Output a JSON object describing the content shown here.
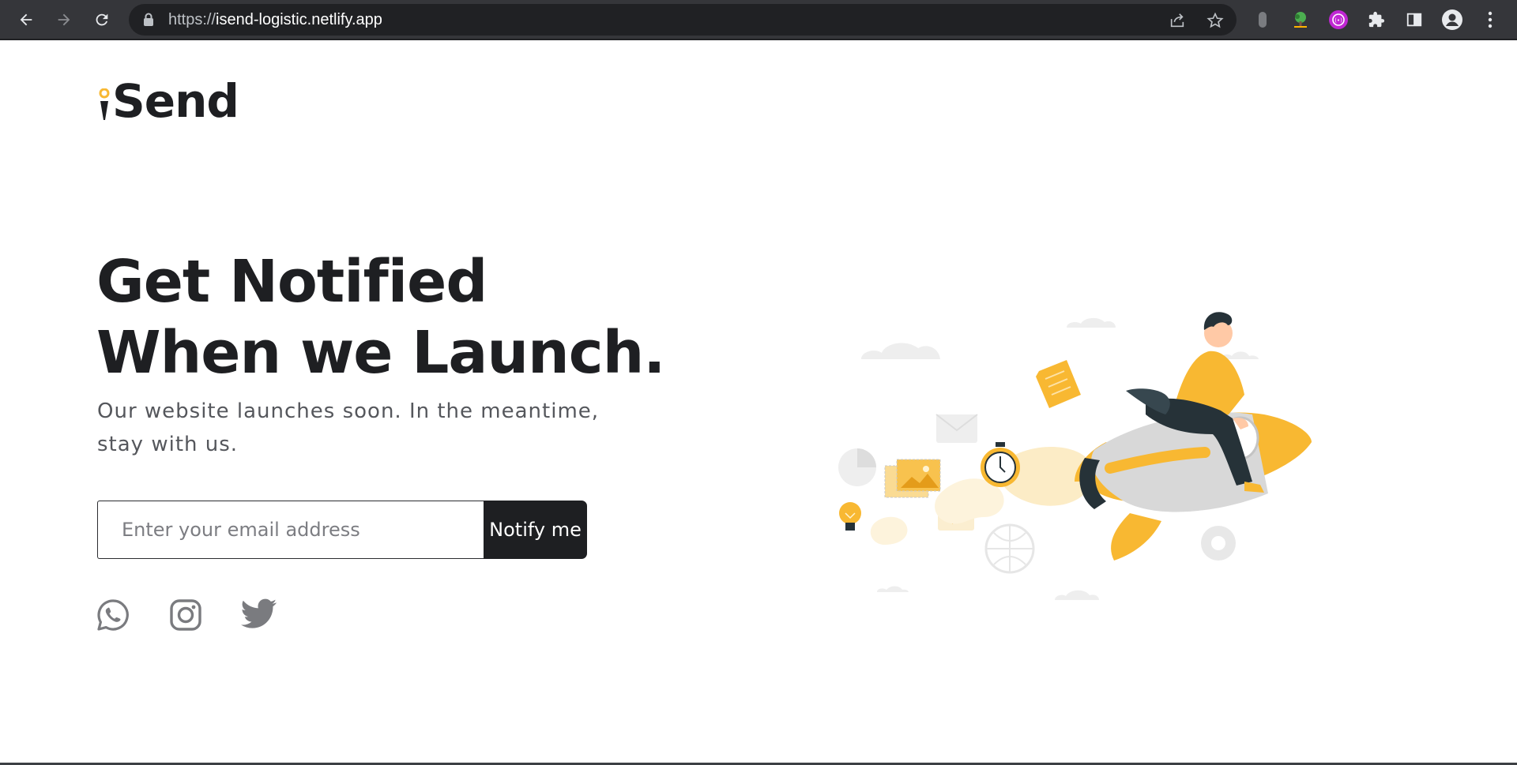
{
  "browser": {
    "url_scheme": "https://",
    "url_host": "isend-logistic.netlify.app",
    "icons": [
      "back-arrow-icon",
      "forward-arrow-icon",
      "reload-icon",
      "lock-icon",
      "share-icon",
      "star-icon",
      "profile-icon",
      "menu-dots-icon",
      "puzzle-icon",
      "sidebar-icon"
    ]
  },
  "logo": {
    "text": "Send"
  },
  "hero": {
    "headline_line1": "Get Notified",
    "headline_line2": "When we Launch.",
    "subtext": "Our website launches soon. In the meantime, stay with us."
  },
  "form": {
    "email_placeholder": "Enter your email address",
    "button_label": "Notify me"
  },
  "social": [
    "whatsapp-icon",
    "instagram-icon",
    "twitter-icon"
  ],
  "colors": {
    "accent": "#f8b832",
    "dark": "#1e1f22",
    "chrome": "#35363a"
  }
}
